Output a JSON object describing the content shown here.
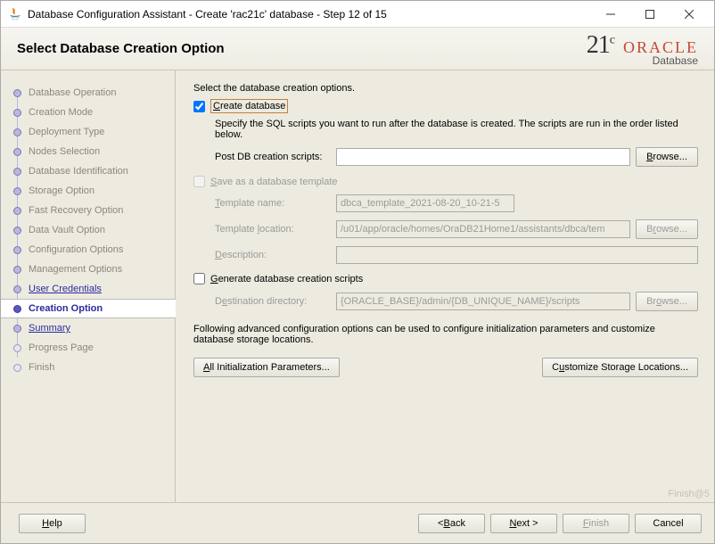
{
  "window": {
    "title": "Database Configuration Assistant - Create 'rac21c' database - Step 12 of 15"
  },
  "header": {
    "title": "Select Database Creation Option",
    "logo_21c": "21",
    "logo_sup": "c",
    "logo_oracle": "ORACLE",
    "logo_db": "Database"
  },
  "sidebar": {
    "steps": [
      {
        "label": "Database Operation",
        "state": "done"
      },
      {
        "label": "Creation Mode",
        "state": "done"
      },
      {
        "label": "Deployment Type",
        "state": "done"
      },
      {
        "label": "Nodes Selection",
        "state": "done"
      },
      {
        "label": "Database Identification",
        "state": "done"
      },
      {
        "label": "Storage Option",
        "state": "done"
      },
      {
        "label": "Fast Recovery Option",
        "state": "done"
      },
      {
        "label": "Data Vault Option",
        "state": "done"
      },
      {
        "label": "Configuration Options",
        "state": "done"
      },
      {
        "label": "Management Options",
        "state": "done"
      },
      {
        "label": "User Credentials",
        "state": "link"
      },
      {
        "label": "Creation Option",
        "state": "current"
      },
      {
        "label": "Summary",
        "state": "link"
      },
      {
        "label": "Progress Page",
        "state": "future"
      },
      {
        "label": "Finish",
        "state": "future"
      }
    ]
  },
  "content": {
    "intro": "Select the database creation options.",
    "create_db_label": "Create database",
    "create_db_checked": true,
    "create_db_desc": "Specify the SQL scripts you want to run after the database is created. The scripts are run in the order listed below.",
    "post_db_label": "Post DB creation scripts:",
    "post_db_value": "",
    "browse_label": "Browse...",
    "save_template_label": "Save as a database template",
    "save_template_checked": false,
    "template_name_label": "Template name:",
    "template_name_value": "dbca_template_2021-08-20_10-21-5",
    "template_loc_label": "Template location:",
    "template_loc_value": "/u01/app/oracle/homes/OraDB21Home1/assistants/dbca/tem",
    "template_desc_label": "Description:",
    "template_desc_value": "",
    "gen_scripts_label": "Generate database creation scripts",
    "gen_scripts_checked": false,
    "dest_dir_label": "Destination directory:",
    "dest_dir_value": "{ORACLE_BASE}/admin/{DB_UNIQUE_NAME}/scripts",
    "advanced_intro": "Following advanced configuration options can be used to configure initialization parameters and customize database storage locations.",
    "all_init_params_label": "All Initialization Parameters...",
    "customize_storage_label": "Customize Storage Locations..."
  },
  "footer": {
    "help": "Help",
    "back": "< Back",
    "next": "Next >",
    "finish": "Finish",
    "cancel": "Cancel"
  },
  "watermark": "Finish@5"
}
